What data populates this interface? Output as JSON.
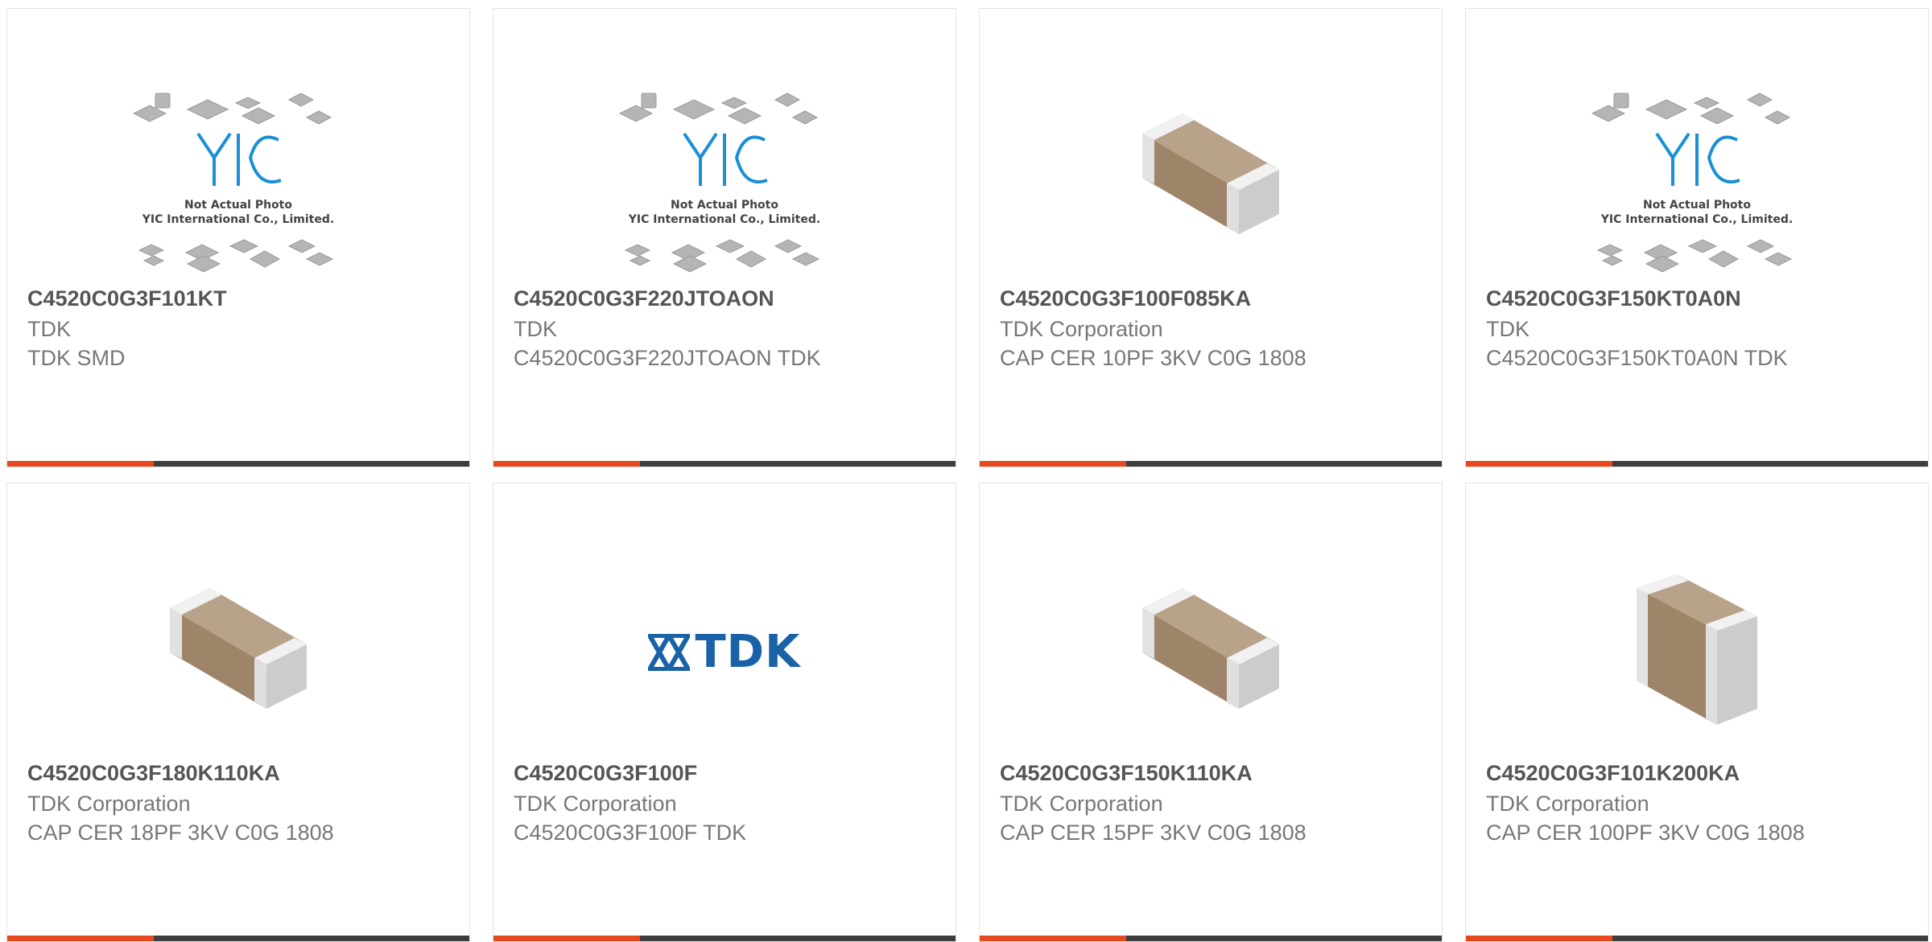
{
  "products": [
    {
      "part_number": "C4520C0G3F101KT",
      "manufacturer": "TDK",
      "description": "TDK SMD",
      "image": "yic-placeholder"
    },
    {
      "part_number": "C4520C0G3F220JTOAON",
      "manufacturer": "TDK",
      "description": "C4520C0G3F220JTOAON TDK",
      "image": "yic-placeholder"
    },
    {
      "part_number": "C4520C0G3F100F085KA",
      "manufacturer": "TDK Corporation",
      "description": "CAP CER 10PF 3KV C0G 1808",
      "image": "capacitor-chip"
    },
    {
      "part_number": "C4520C0G3F150KT0A0N",
      "manufacturer": "TDK",
      "description": "C4520C0G3F150KT0A0N TDK",
      "image": "yic-placeholder"
    },
    {
      "part_number": "C4520C0G3F180K110KA",
      "manufacturer": "TDK Corporation",
      "description": "CAP CER 18PF 3KV C0G 1808",
      "image": "capacitor-chip"
    },
    {
      "part_number": "C4520C0G3F100F",
      "manufacturer": "TDK Corporation",
      "description": "C4520C0G3F100F TDK",
      "image": "tdk-logo"
    },
    {
      "part_number": "C4520C0G3F150K110KA",
      "manufacturer": "TDK Corporation",
      "description": "CAP CER 15PF 3KV C0G 1808",
      "image": "capacitor-chip"
    },
    {
      "part_number": "C4520C0G3F101K200KA",
      "manufacturer": "TDK Corporation",
      "description": "CAP CER 100PF 3KV C0G 1808",
      "image": "capacitor-chip-tall"
    }
  ],
  "placeholder": {
    "brand": "YIC",
    "caption_line1": "Not Actual Photo",
    "caption_line2": "YIC International Co., Limited."
  },
  "tdk_logo_text": "TDK",
  "colors": {
    "accent": "#e8481e",
    "bar_dark": "#3d3d3d",
    "tdk_blue": "#1a62a8",
    "yic_blue": "#1b8fd6"
  }
}
